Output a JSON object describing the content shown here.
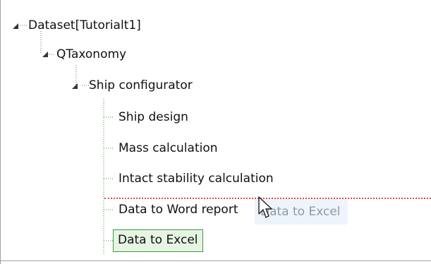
{
  "tree": {
    "root": {
      "label": "Dataset[Tutorialt1]"
    },
    "level1": {
      "label": "QTaxonomy"
    },
    "level2": {
      "label": "Ship configurator"
    },
    "leaves": [
      {
        "label": "Ship design"
      },
      {
        "label": "Mass calculation"
      },
      {
        "label": "Intact stability calculation"
      },
      {
        "label": "Data to Word report"
      },
      {
        "label": "Data to Excel"
      }
    ],
    "selected_index": 4
  },
  "drag": {
    "ghost_label": "Data to Excel"
  },
  "colors": {
    "guide": "#3f9a3a",
    "selection_border": "#3f9a3a",
    "selection_fill": "#e6f4e4",
    "drop_indicator": "#e0484c"
  }
}
